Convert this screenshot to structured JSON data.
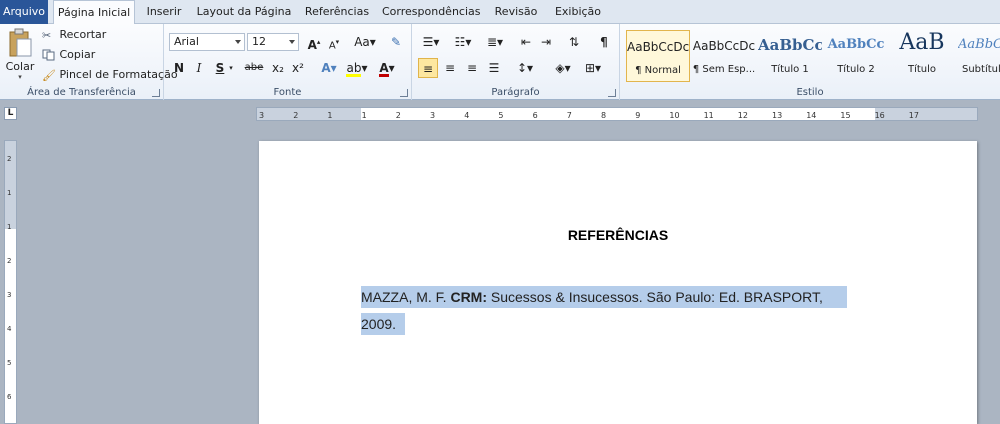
{
  "tabs": [
    "Arquivo",
    "Página Inicial",
    "Inserir",
    "Layout da Página",
    "Referências",
    "Correspondências",
    "Revisão",
    "Exibição"
  ],
  "clipboard": {
    "paste": "Colar",
    "cut": "Recortar",
    "copy": "Copiar",
    "format_painter": "Pincel de Formatação",
    "label": "Área de Transferência"
  },
  "font": {
    "family": "Arial",
    "size": "12",
    "label": "Fonte",
    "bold": "N",
    "italic": "I",
    "underline": "S",
    "strike": "abe",
    "subscript": "x₂",
    "superscript": "x²",
    "grow": "A",
    "shrink": "A",
    "case": "Aa",
    "font_color": "A",
    "highlight_color": "#ffff00",
    "font_color_value": "#c00000"
  },
  "paragraph": {
    "label": "Parágrafo",
    "pilcrow": "¶"
  },
  "styles": {
    "label": "Estilo",
    "items": [
      {
        "preview": "AaBbCcDc",
        "name": "¶ Normal"
      },
      {
        "preview": "AaBbCcDc",
        "name": "¶ Sem Esp..."
      },
      {
        "preview": "AaBbCc",
        "name": "Título 1"
      },
      {
        "preview": "AaBbCc",
        "name": "Título 2"
      },
      {
        "preview": "AaB",
        "name": "Título"
      },
      {
        "preview": "AaBbCc",
        "name": "Subtítulo"
      }
    ]
  },
  "ruler": {
    "corner": "L",
    "ticks": [
      "3",
      "2",
      "1",
      "1",
      "2",
      "3",
      "4",
      "5",
      "6",
      "7",
      "8",
      "9",
      "10",
      "11",
      "12",
      "13",
      "14",
      "15",
      "16",
      "17"
    ],
    "vticks": [
      "2",
      "1",
      "1",
      "2",
      "3",
      "4",
      "5",
      "6"
    ]
  },
  "document": {
    "heading": "REFERÊNCIAS",
    "ref_author": "MAZZA, M. F. ",
    "ref_title": "CRM:",
    "ref_rest": " Sucessos & Insucessos. São Paulo: Ed. BRASPORT,",
    "ref_line2": "2009."
  },
  "colors": {
    "selection": "#b5cdea",
    "file_tab": "#2a5699"
  }
}
